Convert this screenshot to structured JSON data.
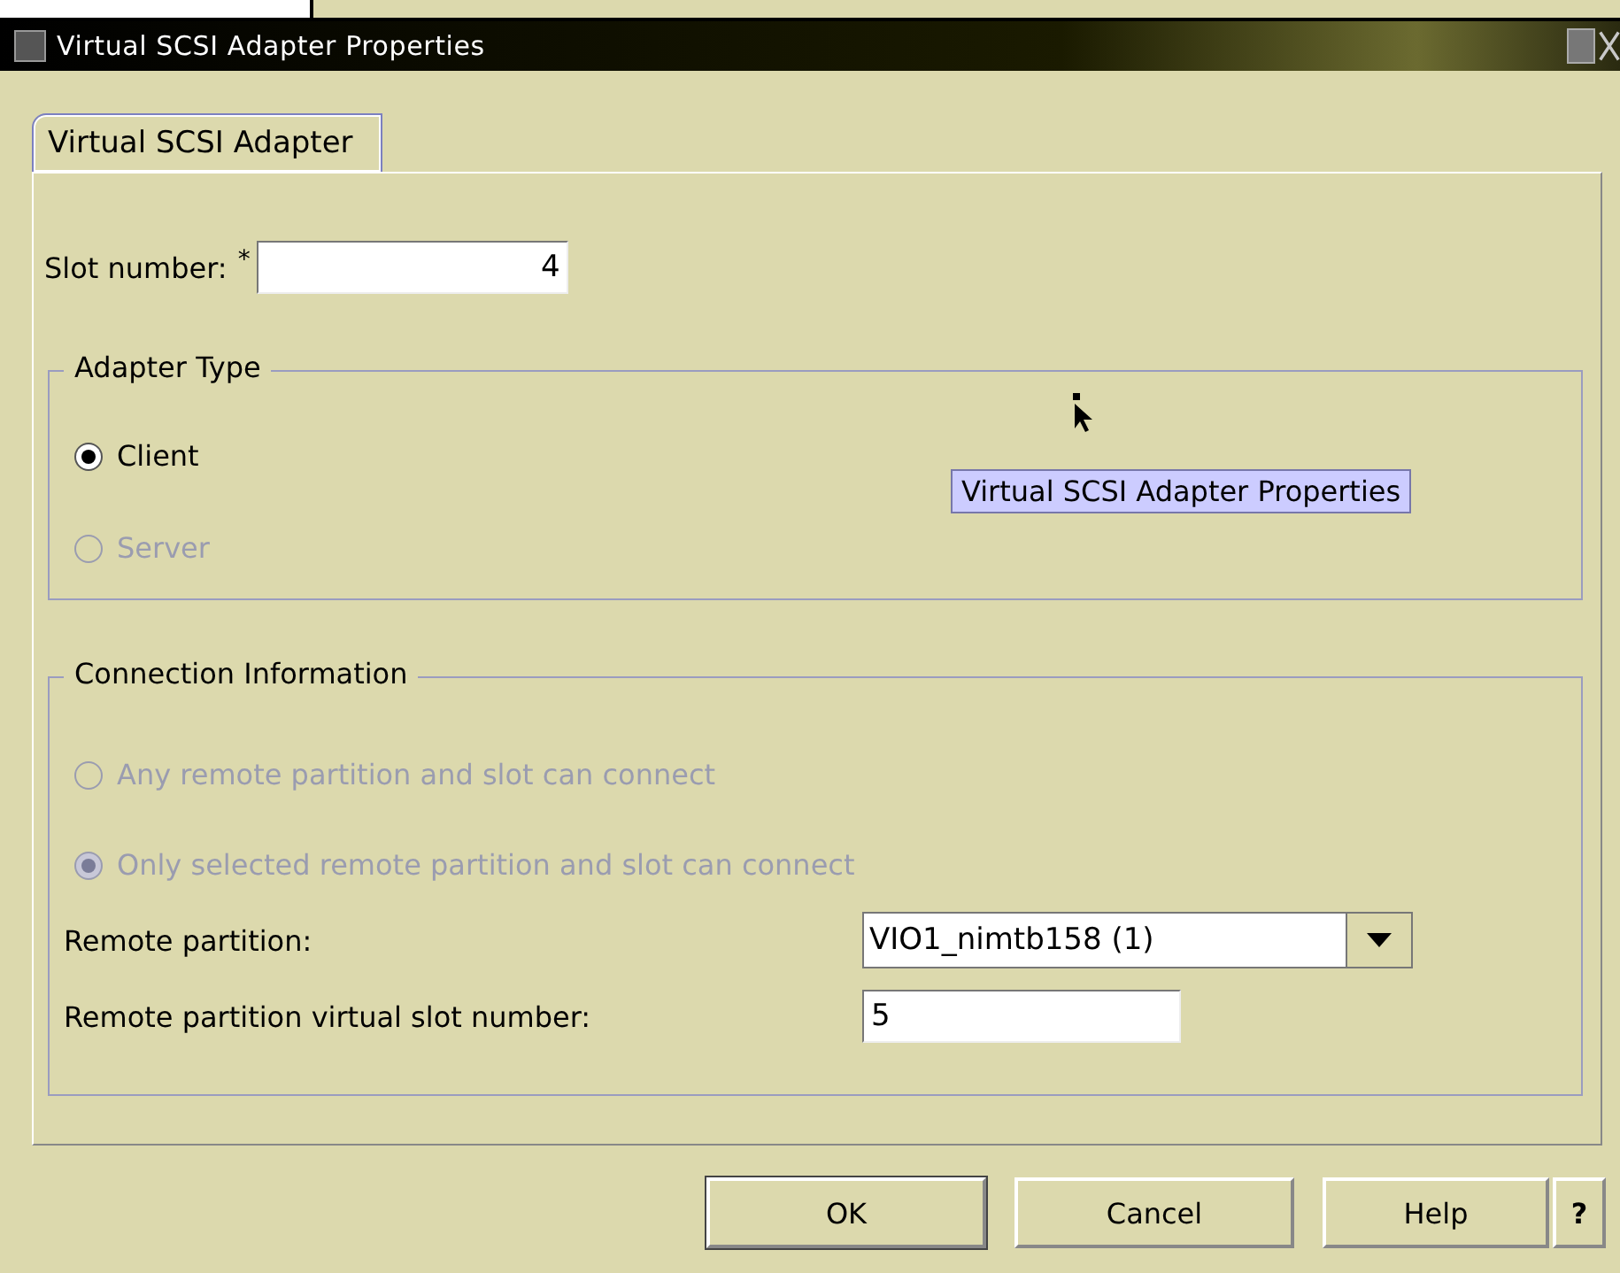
{
  "window": {
    "title": "Virtual SCSI Adapter Properties"
  },
  "tabs": [
    {
      "label": "Virtual SCSI Adapter",
      "selected": true
    }
  ],
  "slot_number": {
    "label": "Slot number:",
    "required_mark": "*",
    "value": "4"
  },
  "adapter_type": {
    "title": "Adapter Type",
    "options": [
      {
        "label": "Client",
        "selected": true,
        "disabled": false
      },
      {
        "label": "Server",
        "selected": false,
        "disabled": true
      }
    ]
  },
  "tooltip": "Virtual SCSI Adapter Properties",
  "connection_information": {
    "title": "Connection Information",
    "options": [
      {
        "label": "Any remote partition and slot can connect",
        "selected": false,
        "disabled": true
      },
      {
        "label": "Only selected remote partition and slot can connect",
        "selected": true,
        "disabled": true
      }
    ],
    "remote_partition": {
      "label": "Remote partition:",
      "value": "VIO1_nimtb158 (1)"
    },
    "remote_slot": {
      "label": "Remote partition virtual slot number:",
      "value": "5"
    }
  },
  "buttons": [
    {
      "label": "OK",
      "kind": "default"
    },
    {
      "label": "Cancel",
      "kind": "normal"
    },
    {
      "label": "Help",
      "kind": "normal"
    },
    {
      "label": "?",
      "kind": "small"
    }
  ]
}
